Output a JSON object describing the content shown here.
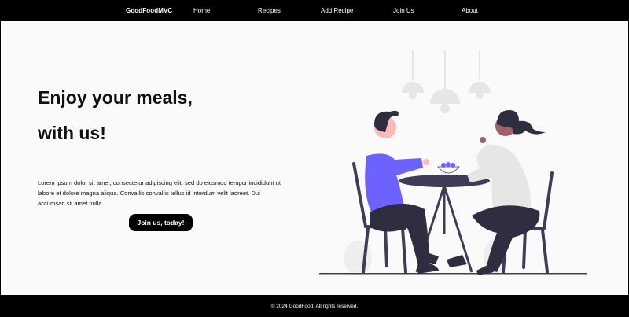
{
  "navbar": {
    "brand": "GoodFoodMVC",
    "links": [
      "Home",
      "Recipes",
      "Add Recipe",
      "Join Us",
      "About"
    ]
  },
  "hero": {
    "headline_line1": "Enjoy your meals,",
    "headline_line2": "with us!",
    "lead": "Lorem ipsum dolor sit amet, consectetur adipiscing elit, sed do eiusmod tempor incididunt ut labore et dolore magna aliqua. Convallis convallis tellus id interdum velit laoreet. Dui accumsan sit amet nulla.",
    "cta_label": "Join us, today!"
  },
  "footer": {
    "copyright": "© 2024 GoodFood. All rights reserved."
  },
  "colors": {
    "navbar_bg": "#000000",
    "page_bg": "#fbfafb",
    "accent_shirt": "#6c63ff",
    "dark_figure": "#2f2e41"
  }
}
